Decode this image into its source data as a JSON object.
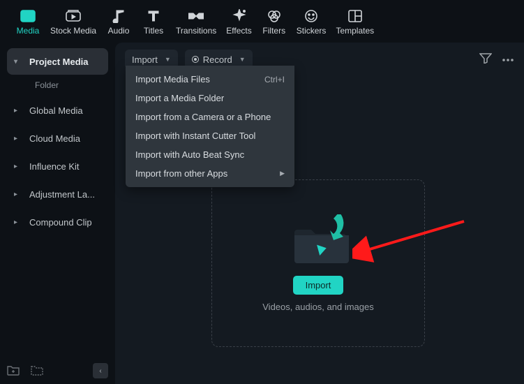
{
  "topnav": [
    {
      "key": "media",
      "label": "Media",
      "active": true
    },
    {
      "key": "stock-media",
      "label": "Stock Media"
    },
    {
      "key": "audio",
      "label": "Audio"
    },
    {
      "key": "titles",
      "label": "Titles"
    },
    {
      "key": "transitions",
      "label": "Transitions"
    },
    {
      "key": "effects",
      "label": "Effects"
    },
    {
      "key": "filters",
      "label": "Filters"
    },
    {
      "key": "stickers",
      "label": "Stickers"
    },
    {
      "key": "templates",
      "label": "Templates"
    }
  ],
  "sidebar": {
    "project_media": "Project Media",
    "folder": "Folder",
    "items": [
      {
        "label": "Global Media"
      },
      {
        "label": "Cloud Media"
      },
      {
        "label": "Influence Kit"
      },
      {
        "label": "Adjustment La..."
      },
      {
        "label": "Compound Clip"
      }
    ]
  },
  "toolbar": {
    "import_label": "Import",
    "record_label": "Record"
  },
  "import_menu": [
    {
      "label": "Import Media Files",
      "shortcut": "Ctrl+I"
    },
    {
      "label": "Import a Media Folder"
    },
    {
      "label": "Import from a Camera or a Phone"
    },
    {
      "label": "Import with Instant Cutter Tool"
    },
    {
      "label": "Import with Auto Beat Sync"
    },
    {
      "label": "Import from other Apps",
      "submenu": true
    }
  ],
  "dropzone": {
    "button_label": "Import",
    "hint": "Videos, audios, and images"
  }
}
